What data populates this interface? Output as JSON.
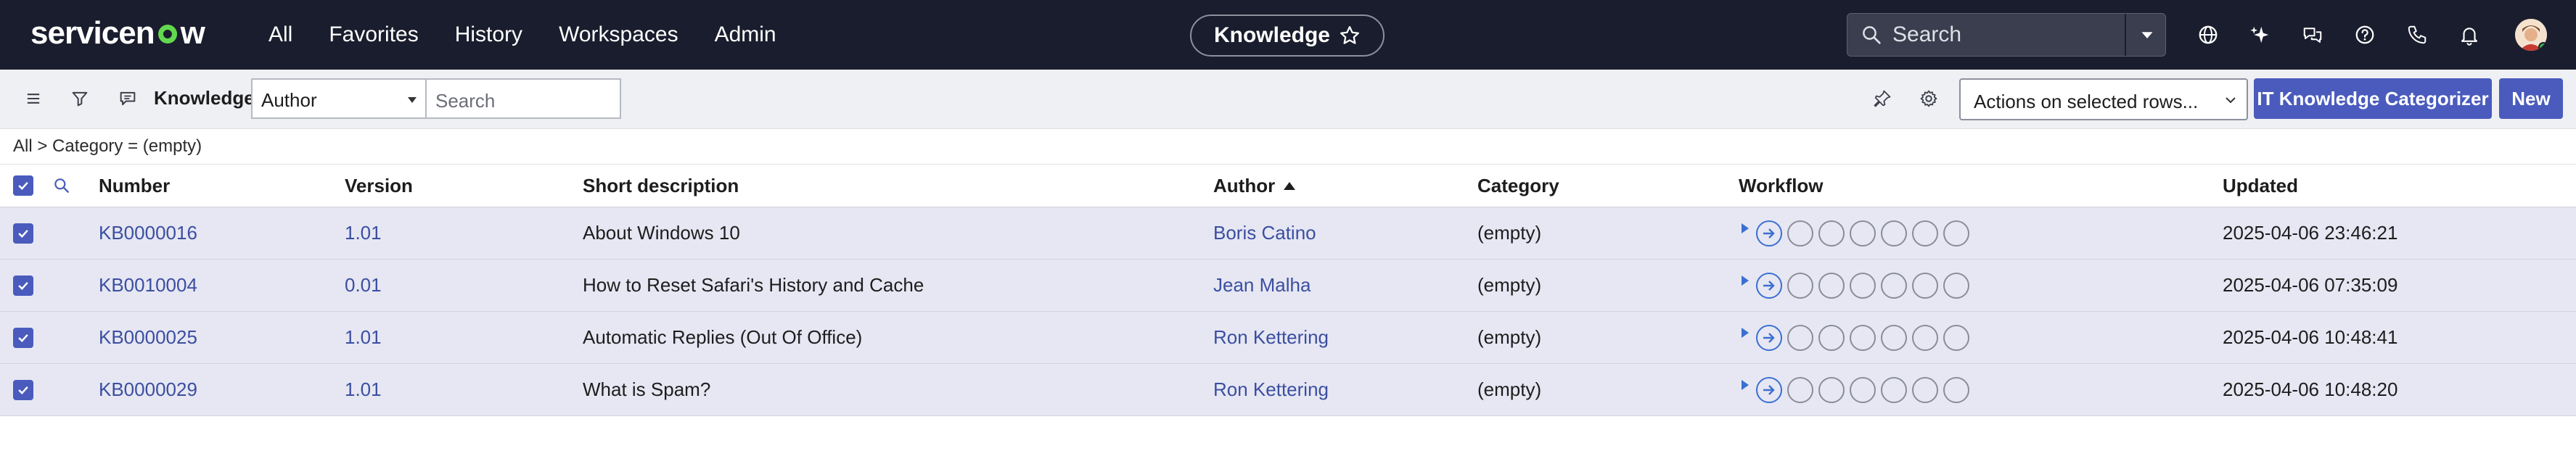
{
  "brand": {
    "logo_text_left": "servicen",
    "logo_text_right": "w"
  },
  "topnav": {
    "links": [
      "All",
      "Favorites",
      "History",
      "Workspaces",
      "Admin"
    ],
    "context_pill": "Knowledge",
    "search_placeholder": "Search",
    "icons": [
      "globe-icon",
      "sparkle-icon",
      "chat-icon",
      "help-icon",
      "phone-icon",
      "bell-icon"
    ]
  },
  "toolbar": {
    "list_title": "Knowledge",
    "field_select": "Author",
    "search_placeholder": "Search",
    "actions_select": "Actions on selected rows...",
    "categorizer_button": "IT Knowledge Categorizer",
    "new_button": "New"
  },
  "breadcrumb": "All > Category = (empty)",
  "table": {
    "columns": [
      "Number",
      "Version",
      "Short description",
      "Author",
      "Category",
      "Workflow",
      "Updated"
    ],
    "sorted_column": "Author",
    "sort_direction": "ascending",
    "rows": [
      {
        "number": "KB0000016",
        "version": "1.01",
        "short_description": "About Windows 10",
        "author": "Boris Catino",
        "category": "(empty)",
        "updated": "2025-04-06 23:46:21",
        "selected": true
      },
      {
        "number": "KB0010004",
        "version": "0.01",
        "short_description": "How to Reset Safari's History and Cache",
        "author": "Jean Malha",
        "category": "(empty)",
        "updated": "2025-04-06 07:35:09",
        "selected": true
      },
      {
        "number": "KB0000025",
        "version": "1.01",
        "short_description": "Automatic Replies (Out Of Office)",
        "author": "Ron Kettering",
        "category": "(empty)",
        "updated": "2025-04-06 10:48:41",
        "selected": true
      },
      {
        "number": "KB0000029",
        "version": "1.01",
        "short_description": "What is Spam?",
        "author": "Ron Kettering",
        "category": "(empty)",
        "updated": "2025-04-06 10:48:20",
        "selected": true
      }
    ]
  },
  "colors": {
    "nav_bg": "#1a1d2d",
    "accent": "#4a5bbd",
    "row_selected": "#e6e7f3",
    "link": "#3b4ea0"
  }
}
